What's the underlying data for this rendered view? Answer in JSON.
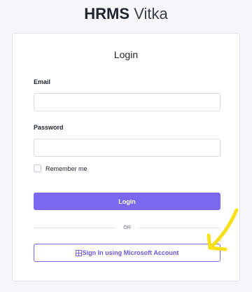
{
  "brand": {
    "strong": "HRMS",
    "light": "Vitka"
  },
  "login_card": {
    "title": "Login",
    "email_label": "Email",
    "email_value": "",
    "password_label": "Password",
    "password_value": "",
    "remember_label": "Remember me",
    "remember_checked": false,
    "login_button": "Login",
    "divider_text": "OR",
    "ms_icon": "microsoft-grid-icon",
    "ms_button": "Sign In using Microsoft Account"
  },
  "annotation": {
    "arrow_color": "#f7e019"
  },
  "colors": {
    "accent": "#7b68ee",
    "background": "#f7f7fb"
  }
}
